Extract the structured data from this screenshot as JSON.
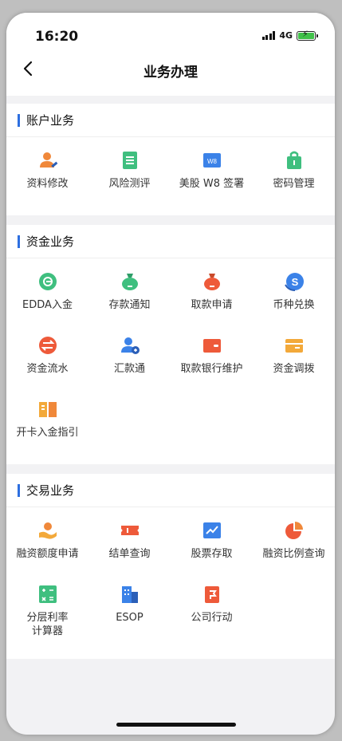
{
  "status": {
    "time": "16:20",
    "network": "4G"
  },
  "nav": {
    "title": "业务办理"
  },
  "colors": {
    "accent": "#2d6fe0",
    "orange": "#f0883a",
    "green": "#3fbf7f",
    "blue": "#3b82e8",
    "red": "#ee5a3a",
    "yellow": "#f3a93a"
  },
  "sections": [
    {
      "title": "账户业务",
      "items": [
        {
          "label": "资料修改",
          "icon": "user-edit-icon"
        },
        {
          "label": "风险测评",
          "icon": "clipboard-icon"
        },
        {
          "label": "美股 W8 签署",
          "icon": "w8-form-icon"
        },
        {
          "label": "密码管理",
          "icon": "lock-bag-icon"
        }
      ]
    },
    {
      "title": "资金业务",
      "items": [
        {
          "label": "EDDA入金",
          "icon": "edda-icon"
        },
        {
          "label": "存款通知",
          "icon": "deposit-bag-icon"
        },
        {
          "label": "取款申请",
          "icon": "withdraw-bag-icon"
        },
        {
          "label": "币种兑换",
          "icon": "currency-exchange-icon"
        },
        {
          "label": "资金流水",
          "icon": "transfer-flow-icon"
        },
        {
          "label": "汇款通",
          "icon": "remit-user-icon"
        },
        {
          "label": "取款银行维护",
          "icon": "bank-card-icon"
        },
        {
          "label": "资金调拨",
          "icon": "wallet-icon"
        },
        {
          "label": "开卡入金指引",
          "icon": "guide-book-icon"
        }
      ]
    },
    {
      "title": "交易业务",
      "items": [
        {
          "label": "融资额度申请",
          "icon": "hand-coin-icon"
        },
        {
          "label": "结单查询",
          "icon": "ticket-icon"
        },
        {
          "label": "股票存取",
          "icon": "stock-chart-icon"
        },
        {
          "label": "融资比例查询",
          "icon": "pie-chart-icon"
        },
        {
          "label": "分层利率计算器",
          "icon": "calculator-icon"
        },
        {
          "label": "ESOP",
          "icon": "building-icon"
        },
        {
          "label": "公司行动",
          "icon": "flag-doc-icon"
        }
      ]
    }
  ]
}
